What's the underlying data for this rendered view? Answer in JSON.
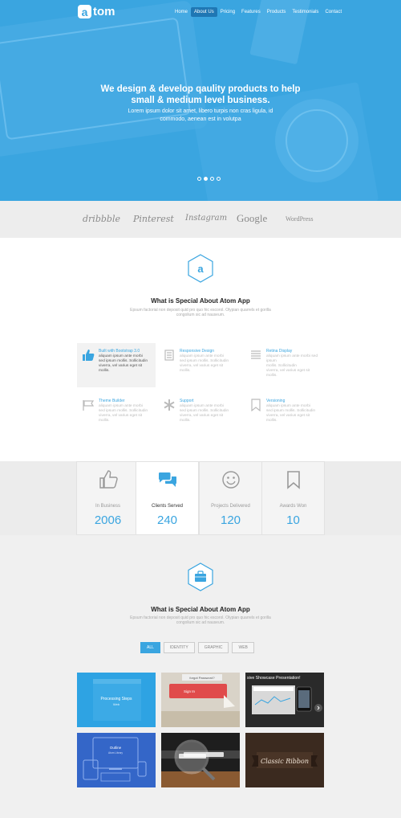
{
  "header": {
    "logo_letter": "a",
    "logo_text": "tom",
    "nav": [
      "Home",
      "About Us",
      "Pricing",
      "Features",
      "Products",
      "Testimonials",
      "Contact"
    ],
    "active_nav": "About Us"
  },
  "hero": {
    "title_line1": "We design & develop qaulity products to help",
    "title_line2": "small & medium level business.",
    "sub_line1": "Lorem ipsum dolor sit amet, libero turpis non cras ligula, id",
    "sub_line2": "commodo, aenean est in volutpa",
    "slide_count": 4,
    "active_slide": 2
  },
  "brands": [
    "dribbble",
    "Pinterest",
    "Instagram",
    "Google",
    "WordPress"
  ],
  "special": {
    "badge_letter": "a",
    "title": "What is Special About Atom App",
    "sub_line1": "Epsum factorial non deposit quid pro quo hic escorol. Olypian quarrels et gorilla",
    "sub_line2": "congolium sic ad nauseum.",
    "features": [
      {
        "title": "Built with Bootstrap 3.0",
        "lines": [
          "aliquam ipsum ante morbi",
          "sed ipsum mollis. Sollicitudin",
          "viverra, vel varius eget sit",
          "mollis."
        ],
        "icon": "thumbs-up-icon"
      },
      {
        "title": "Responsive Design",
        "lines": [
          "aliquam ipsum ante morbi",
          "sed ipsum mollis. Sollicitudin",
          "viverra, vel varius eget sit",
          "mollis."
        ],
        "icon": "document-icon"
      },
      {
        "title": "Retina Display",
        "lines": [
          "aliquam ipsum ante morbi sed ipsum",
          "mollis. Sollicitudin",
          "viverra, vel varius eget sit",
          "mollis."
        ],
        "icon": "list-icon"
      },
      {
        "title": "Theme Builder",
        "lines": [
          "aliquam ipsum ante morbi",
          "sed ipsum mollis. Sollicitudin",
          "viverra, vel varius eget sit",
          "mollis."
        ],
        "icon": "flag-icon"
      },
      {
        "title": "Support",
        "lines": [
          "aliquam ipsum ante morbi",
          "sed ipsum mollis. Sollicitudin",
          "viverra, vel varius eget sit",
          "mollis."
        ],
        "icon": "asterisk-icon"
      },
      {
        "title": "Versioning",
        "lines": [
          "aliquam ipsum ante morbi",
          "sed ipsum mollis. Sollicitudin",
          "viverra, vel varius eget sit",
          "mollis."
        ],
        "icon": "bookmark-icon"
      }
    ]
  },
  "stats": [
    {
      "label": "In Business",
      "value": "2006",
      "icon": "thumbs-up-icon"
    },
    {
      "label": "Clients Served",
      "value": "240",
      "icon": "chat-bubbles-icon"
    },
    {
      "label": "Projects Delivered",
      "value": "120",
      "icon": "smiley-icon"
    },
    {
      "label": "Awards Won",
      "value": "10",
      "icon": "bookmark-icon"
    }
  ],
  "portfolio": {
    "title": "What is Special About Atom App",
    "sub_line1": "Epsum factorial non deposit quid pro quo hic escorol. Olypian quarrels et gorilla",
    "sub_line2": "congolium sic ad nauseum.",
    "filters": [
      "ALL",
      "IDENTITY",
      "GRAPHIC",
      "WEB"
    ],
    "active_filter": "ALL",
    "tiles": [
      {
        "line1": "Processing Steps",
        "line2": "Web"
      },
      {
        "line1": "forgot Password?",
        "line2": "Sign In"
      },
      {
        "line1": "sive Showcase Presentation!",
        "line2": ""
      },
      {
        "line1": "Outline",
        "line2": "Atom Library"
      },
      {
        "line1": "",
        "line2": ""
      },
      {
        "line1": "Classic Ribbon",
        "line2": ""
      }
    ]
  },
  "colors": {
    "accent": "#3aa5e0",
    "accent_dark": "#1f77b4"
  }
}
